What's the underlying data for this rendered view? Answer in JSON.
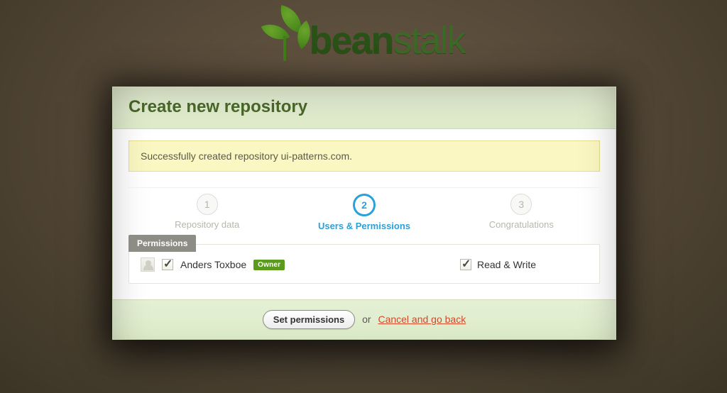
{
  "logo": {
    "bold": "bean",
    "light": "stalk"
  },
  "header": {
    "title": "Create new repository"
  },
  "flash": {
    "message": "Successfully created repository ui-patterns.com."
  },
  "steps": [
    {
      "num": "1",
      "label": "Repository data",
      "active": false
    },
    {
      "num": "2",
      "label": "Users & Permissions",
      "active": true
    },
    {
      "num": "3",
      "label": "Congratulations",
      "active": false
    }
  ],
  "permissions": {
    "tab_label": "Permissions",
    "user": {
      "name": "Anders Toxboe",
      "owner_badge": "Owner",
      "user_checked": true,
      "rw_label": "Read & Write",
      "rw_checked": true
    }
  },
  "footer": {
    "set_label": "Set permissions",
    "or_text": "or",
    "cancel_label": "Cancel and go back"
  }
}
